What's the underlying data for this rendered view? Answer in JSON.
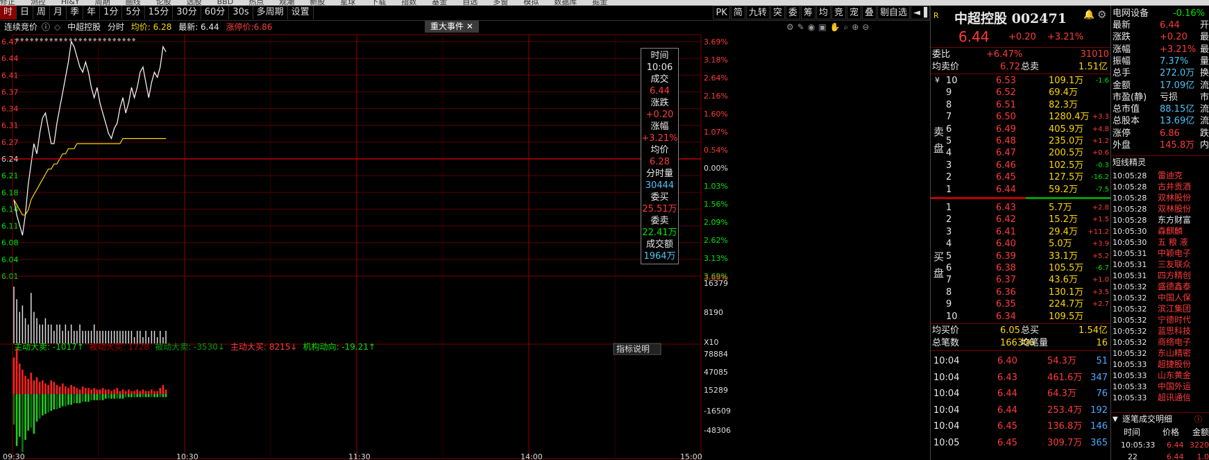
{
  "topmenu": [
    "修正",
    "测控",
    "Hi&Y",
    "周期",
    "画线",
    "论股",
    "选股",
    "BBD",
    "热点",
    "观潮",
    "新股",
    "星球",
    "下载",
    "指数",
    "基金",
    "自选",
    "多窗",
    "模拟",
    "数据库",
    "掘金"
  ],
  "toolbar": {
    "periods": [
      "时",
      "日",
      "周",
      "月",
      "季",
      "年",
      "1分",
      "5分",
      "15分",
      "30分",
      "60分",
      "30s",
      "多周期",
      "设置"
    ],
    "right_tools": [
      "PK",
      "简",
      "九转",
      "突",
      "委",
      "筹",
      "均",
      "竞",
      "宠",
      "叠",
      "剔自选",
      "◄▐"
    ]
  },
  "infobar": {
    "label": "连续竞价",
    "stock": "中超控股",
    "mode": "分时",
    "avg": "均价: 6.28",
    "last": "最新: 6.44",
    "limit": "涨停价:6.86"
  },
  "event_button": "重大事件",
  "chart_data": {
    "type": "line",
    "title": "中超控股 分时",
    "price_axis_left": [
      "6.47",
      "6.44",
      "6.41",
      "6.37",
      "6.34",
      "6.31",
      "6.27",
      "6.24",
      "6.21",
      "6.18",
      "6.14",
      "6.11",
      "6.08",
      "6.04",
      "6.01"
    ],
    "pct_axis_right": [
      "3.69%",
      "3.18%",
      "2.64%",
      "2.16%",
      "1.60%",
      "1.07%",
      "0.54%",
      "0.00%",
      "1.03%",
      "1.56%",
      "2.09%",
      "2.62%",
      "3.13%",
      "3.69%"
    ],
    "prev_close": 6.24,
    "price": [
      6.16,
      6.13,
      6.11,
      6.09,
      6.13,
      6.19,
      6.23,
      6.27,
      6.25,
      6.29,
      6.32,
      6.33,
      6.3,
      6.27,
      6.27,
      6.31,
      6.34,
      6.37,
      6.4,
      6.43,
      6.47,
      6.46,
      6.44,
      6.42,
      6.41,
      6.43,
      6.41,
      6.38,
      6.36,
      6.38,
      6.35,
      6.33,
      6.31,
      6.29,
      6.28,
      6.3,
      6.31,
      6.34,
      6.36,
      6.33,
      6.35,
      6.38,
      6.36,
      6.38,
      6.41,
      6.42,
      6.39,
      6.36,
      6.39,
      6.41,
      6.4,
      6.42,
      6.46,
      6.45
    ],
    "avg": [
      6.16,
      6.15,
      6.14,
      6.13,
      6.13,
      6.14,
      6.16,
      6.17,
      6.18,
      6.19,
      6.2,
      6.21,
      6.22,
      6.22,
      6.23,
      6.23,
      6.24,
      6.25,
      6.25,
      6.26,
      6.26,
      6.26,
      6.27,
      6.27,
      6.27,
      6.27,
      6.27,
      6.27,
      6.27,
      6.27,
      6.27,
      6.27,
      6.27,
      6.27,
      6.27,
      6.27,
      6.27,
      6.27,
      6.28,
      6.28,
      6.28,
      6.28,
      6.28,
      6.28,
      6.28,
      6.28,
      6.28,
      6.28,
      6.28,
      6.28,
      6.28,
      6.28,
      6.28,
      6.28
    ],
    "volume_axis_right": [
      "16379",
      "8190",
      "X10"
    ],
    "volume": [
      9,
      7,
      5,
      6,
      4,
      3,
      8,
      5,
      4,
      3,
      3,
      4,
      3,
      3,
      2,
      3,
      3,
      2,
      3,
      2,
      3,
      2,
      2,
      3,
      2,
      2,
      2,
      2,
      3,
      2,
      2,
      2,
      2,
      2,
      2,
      2,
      2,
      2,
      2,
      2,
      2,
      2,
      1,
      2,
      2,
      1,
      2,
      1,
      2,
      2,
      1,
      2,
      1,
      2
    ],
    "flow_axis_right": [
      "78884",
      "47085",
      "15289",
      "-16509",
      "-48306"
    ],
    "flow_legend": [
      "主动大卖: -1017↑",
      "被动大买: 1728",
      "被动大卖: -3530↓",
      "主动大买: 8215↓",
      "机构动向: -19.21↑"
    ],
    "flow_pos": [
      24,
      30,
      20,
      16,
      12,
      10,
      14,
      9,
      11,
      8,
      9,
      7,
      6,
      9,
      8,
      6,
      5,
      7,
      5,
      4,
      6,
      5,
      4,
      3,
      5,
      4,
      4,
      3,
      4,
      3,
      3,
      4,
      3,
      3,
      2,
      3,
      4,
      2,
      3,
      2,
      3,
      2,
      2,
      3,
      2,
      3,
      2,
      2,
      3,
      2,
      2,
      4,
      6,
      3
    ],
    "flow_neg": [
      -20,
      -34,
      -28,
      -38,
      -30,
      -24,
      -22,
      -26,
      -18,
      -16,
      -14,
      -13,
      -12,
      -11,
      -10,
      -10,
      -9,
      -8,
      -8,
      -7,
      -7,
      -6,
      -6,
      -6,
      -5,
      -5,
      -5,
      -4,
      -4,
      -4,
      -4,
      -4,
      -3,
      -3,
      -3,
      -3,
      -3,
      -3,
      -3,
      -2,
      -2,
      -2,
      -2,
      -2,
      -2,
      -2,
      -2,
      -2,
      -2,
      -2,
      -2,
      -2,
      -2,
      -2
    ],
    "x_labels": [
      "09:30",
      "10:30",
      "11:30",
      "14:00",
      "15:00"
    ],
    "indicator_btn": "指标说明"
  },
  "tooltip": [
    {
      "k": "时间",
      "v": "10:06",
      "c": "wht"
    },
    {
      "k": "成交",
      "v": "6.44",
      "c": "red"
    },
    {
      "k": "涨跌",
      "v": "+0.20",
      "c": "red"
    },
    {
      "k": "涨幅",
      "v": "+3.21%",
      "c": "red"
    },
    {
      "k": "均价",
      "v": "6.28",
      "c": "red"
    },
    {
      "k": "分时量",
      "v": "30444",
      "c": "cyn"
    },
    {
      "k": "委买",
      "v": "25.51万",
      "c": "red"
    },
    {
      "k": "委卖",
      "v": "22.41万",
      "c": "grn"
    },
    {
      "k": "成交额",
      "v": "1964万",
      "c": "cyn"
    }
  ],
  "quote": {
    "r": "R",
    "name": "中超控股",
    "code": "002471",
    "price": "6.44",
    "chg": "+0.20",
    "pct": "+3.21%"
  },
  "ob_header": {
    "wb_k": "委比",
    "wb_v": "+6.47%",
    "wc_v": "31010",
    "avgsell_k": "均卖价",
    "avgsell_v": "6.72",
    "totalsell_k": "总卖",
    "totalsell_v": "1.51亿"
  },
  "sells": [
    {
      "n": "10",
      "p": "6.53",
      "v": "109.1万",
      "d": "-1.6"
    },
    {
      "n": "9",
      "p": "6.52",
      "v": "69.4万",
      "d": ""
    },
    {
      "n": "8",
      "p": "6.51",
      "v": "82.3万",
      "d": ""
    },
    {
      "n": "7",
      "p": "6.50",
      "v": "1280.4万",
      "d": "+3.3"
    },
    {
      "n": "6",
      "p": "6.49",
      "v": "405.9万",
      "d": "+4.8"
    },
    {
      "n": "5",
      "p": "6.48",
      "v": "235.0万",
      "d": "+1.2"
    },
    {
      "n": "4",
      "p": "6.47",
      "v": "200.5万",
      "d": "+0.6"
    },
    {
      "n": "3",
      "p": "6.46",
      "v": "102.5万",
      "d": "-0.3"
    },
    {
      "n": "2",
      "p": "6.45",
      "v": "127.5万",
      "d": "-16.2"
    },
    {
      "n": "1",
      "p": "6.44",
      "v": "59.2万",
      "d": "-7.5"
    }
  ],
  "buys": [
    {
      "n": "1",
      "p": "6.43",
      "v": "5.7万",
      "d": "+2.8"
    },
    {
      "n": "2",
      "p": "6.42",
      "v": "15.2万",
      "d": "+1.5"
    },
    {
      "n": "3",
      "p": "6.41",
      "v": "29.4万",
      "d": "+11.2"
    },
    {
      "n": "4",
      "p": "6.40",
      "v": "5.0万",
      "d": "+3.9"
    },
    {
      "n": "5",
      "p": "6.39",
      "v": "33.1万",
      "d": "+5.2"
    },
    {
      "n": "6",
      "p": "6.38",
      "v": "105.5万",
      "d": "-6.7"
    },
    {
      "n": "7",
      "p": "6.37",
      "v": "43.6万",
      "d": "+1.0"
    },
    {
      "n": "8",
      "p": "6.36",
      "v": "130.1万",
      "d": "+3.5"
    },
    {
      "n": "9",
      "p": "6.35",
      "v": "224.7万",
      "d": "+2.7"
    },
    {
      "n": "10",
      "p": "6.34",
      "v": "109.5万",
      "d": ""
    }
  ],
  "sell_side": [
    "卖",
    "盘"
  ],
  "buy_side": [
    "买",
    "盘"
  ],
  "ob_footer": {
    "avgbuy_k": "均买价",
    "avgbuy_v": "6.05",
    "totalbuy_k": "总买",
    "totalbuy_v": "1.54亿",
    "cnt_k": "总笔数",
    "cnt_v": "166306",
    "avgqty_k": "均笔量",
    "avgqty_v": "16"
  },
  "ticks": [
    {
      "t": "10:04",
      "p": "6.40",
      "v": "54.3万",
      "n": "51"
    },
    {
      "t": "10:04",
      "p": "6.43",
      "v": "461.6万",
      "n": "347"
    },
    {
      "t": "10:04",
      "p": "6.44",
      "v": "64.3万",
      "n": "76"
    },
    {
      "t": "10:04",
      "p": "6.44",
      "v": "253.4万",
      "n": "192"
    },
    {
      "t": "10:04",
      "p": "6.45",
      "v": "136.8万",
      "n": "146"
    },
    {
      "t": "10:05",
      "p": "6.45",
      "v": "309.7万",
      "n": "365"
    }
  ],
  "sector": {
    "name": "电网设备",
    "pct": "-0.16%"
  },
  "stats": [
    {
      "k": "最新",
      "v": "6.44",
      "u": "开",
      "c": "red"
    },
    {
      "k": "涨跌",
      "v": "+0.20",
      "u": "最",
      "c": "red"
    },
    {
      "k": "涨幅",
      "v": "+3.21%",
      "u": "最",
      "c": "red"
    },
    {
      "k": "振幅",
      "v": "7.37%",
      "u": "量",
      "c": "cyn"
    },
    {
      "k": "总手",
      "v": "272.0万",
      "u": "换",
      "c": "cyn"
    },
    {
      "k": "金额",
      "v": "17.09亿",
      "u": "流",
      "c": "cyn"
    },
    {
      "k": "市盈(静)",
      "v": "亏损",
      "u": "市",
      "c": "wht"
    },
    {
      "k": "总市值",
      "v": "88.15亿",
      "u": "流",
      "c": "cyn"
    },
    {
      "k": "总股本",
      "v": "13.69亿",
      "u": "流",
      "c": "cyn"
    },
    {
      "k": "涨停",
      "v": "6.86",
      "u": "跌",
      "c": "red"
    },
    {
      "k": "外盘",
      "v": "145.8万",
      "u": "内",
      "c": "red"
    }
  ],
  "short_title": "短线精灵",
  "short": [
    {
      "t": "10:05:28",
      "n": "雷迪克",
      "c": "red"
    },
    {
      "t": "10:05:28",
      "n": "古井贡酒",
      "c": "red"
    },
    {
      "t": "10:05:28",
      "n": "双林股份",
      "c": "red"
    },
    {
      "t": "10:05:28",
      "n": "双林股份",
      "c": "red"
    },
    {
      "t": "10:05:28",
      "n": "东方财富",
      "c": "wht"
    },
    {
      "t": "10:05:30",
      "n": "森麒麟",
      "c": "red"
    },
    {
      "t": "10:05:30",
      "n": "五 粮 液",
      "c": "red"
    },
    {
      "t": "10:05:31",
      "n": "中颖电子",
      "c": "red"
    },
    {
      "t": "10:05:31",
      "n": "三友联众",
      "c": "red"
    },
    {
      "t": "10:05:31",
      "n": "四方精创",
      "c": "red"
    },
    {
      "t": "10:05:32",
      "n": "盛德鑫泰",
      "c": "red"
    },
    {
      "t": "10:05:32",
      "n": "中国人保",
      "c": "red"
    },
    {
      "t": "10:05:32",
      "n": "滨江集团",
      "c": "red"
    },
    {
      "t": "10:05:32",
      "n": "宁德时代",
      "c": "red"
    },
    {
      "t": "10:05:32",
      "n": "蓝思科技",
      "c": "red"
    },
    {
      "t": "10:05:32",
      "n": "商络电子",
      "c": "red"
    },
    {
      "t": "10:05:32",
      "n": "东山精密",
      "c": "red"
    },
    {
      "t": "10:05:33",
      "n": "超捷股份",
      "c": "red"
    },
    {
      "t": "10:05:33",
      "n": "山东黄金",
      "c": "red"
    },
    {
      "t": "10:05:33",
      "n": "中国外运",
      "c": "red"
    },
    {
      "t": "10:05:33",
      "n": "超讯通信",
      "c": "red"
    }
  ],
  "tick_detail": {
    "title": "逐笔成交明细",
    "h_time": "时间",
    "h_price": "价格",
    "h_amount": "金额",
    "r_time": "10:05:33",
    "r_price": "6.44",
    "r_amount": "3220",
    "r2_time": "22",
    "r2_price": "6.44",
    "r2_amount": "1.0"
  }
}
